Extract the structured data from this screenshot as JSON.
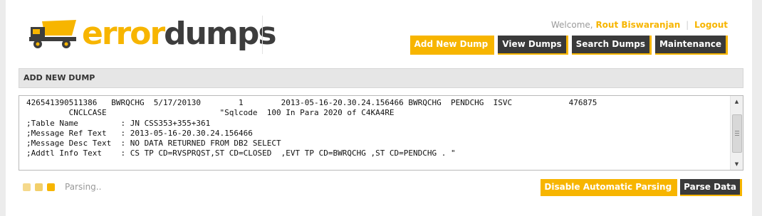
{
  "brand": {
    "logo_part1": "error",
    "logo_part2": "dumps",
    "accent_color": "#f7b500",
    "dark_color": "#3a3a3a"
  },
  "header": {
    "welcome_prefix": "Welcome,",
    "user_name": "Rout Biswaranjan",
    "separator": "|",
    "logout_label": "Logout"
  },
  "nav": {
    "items": [
      {
        "label": "Add New Dump",
        "active": true
      },
      {
        "label": "View Dumps",
        "active": false
      },
      {
        "label": "Search Dumps",
        "active": false
      },
      {
        "label": "Maintenance",
        "active": false
      }
    ]
  },
  "section": {
    "title": "ADD NEW DUMP"
  },
  "dump_text": {
    "lines": [
      "426541390511386   BWRQCHG  5/17/20130        1        2013-05-16-20.30.24.156466 BWRQCHG  PENDCHG  ISVC            476875",
      "         CNCLCASE                        \"Sqlcode  100 In Para 2020 of C4KA4RE",
      ";Table Name         : JN CSS353+355+361",
      ";Message Ref Text   : 2013-05-16-20.30.24.156466",
      ";Message Desc Text  : NO DATA RETURNED FROM DB2 SELECT",
      ";Addtl Info Text    : CS TP CD=RVSPRQST,ST CD=CLOSED  ,EVT TP CD=BWRQCHG ,ST CD=PENDCHG . \""
    ]
  },
  "status": {
    "text": "Parsing.."
  },
  "actions": {
    "disable_parsing_label": "Disable Automatic Parsing",
    "parse_label": "Parse Data"
  }
}
